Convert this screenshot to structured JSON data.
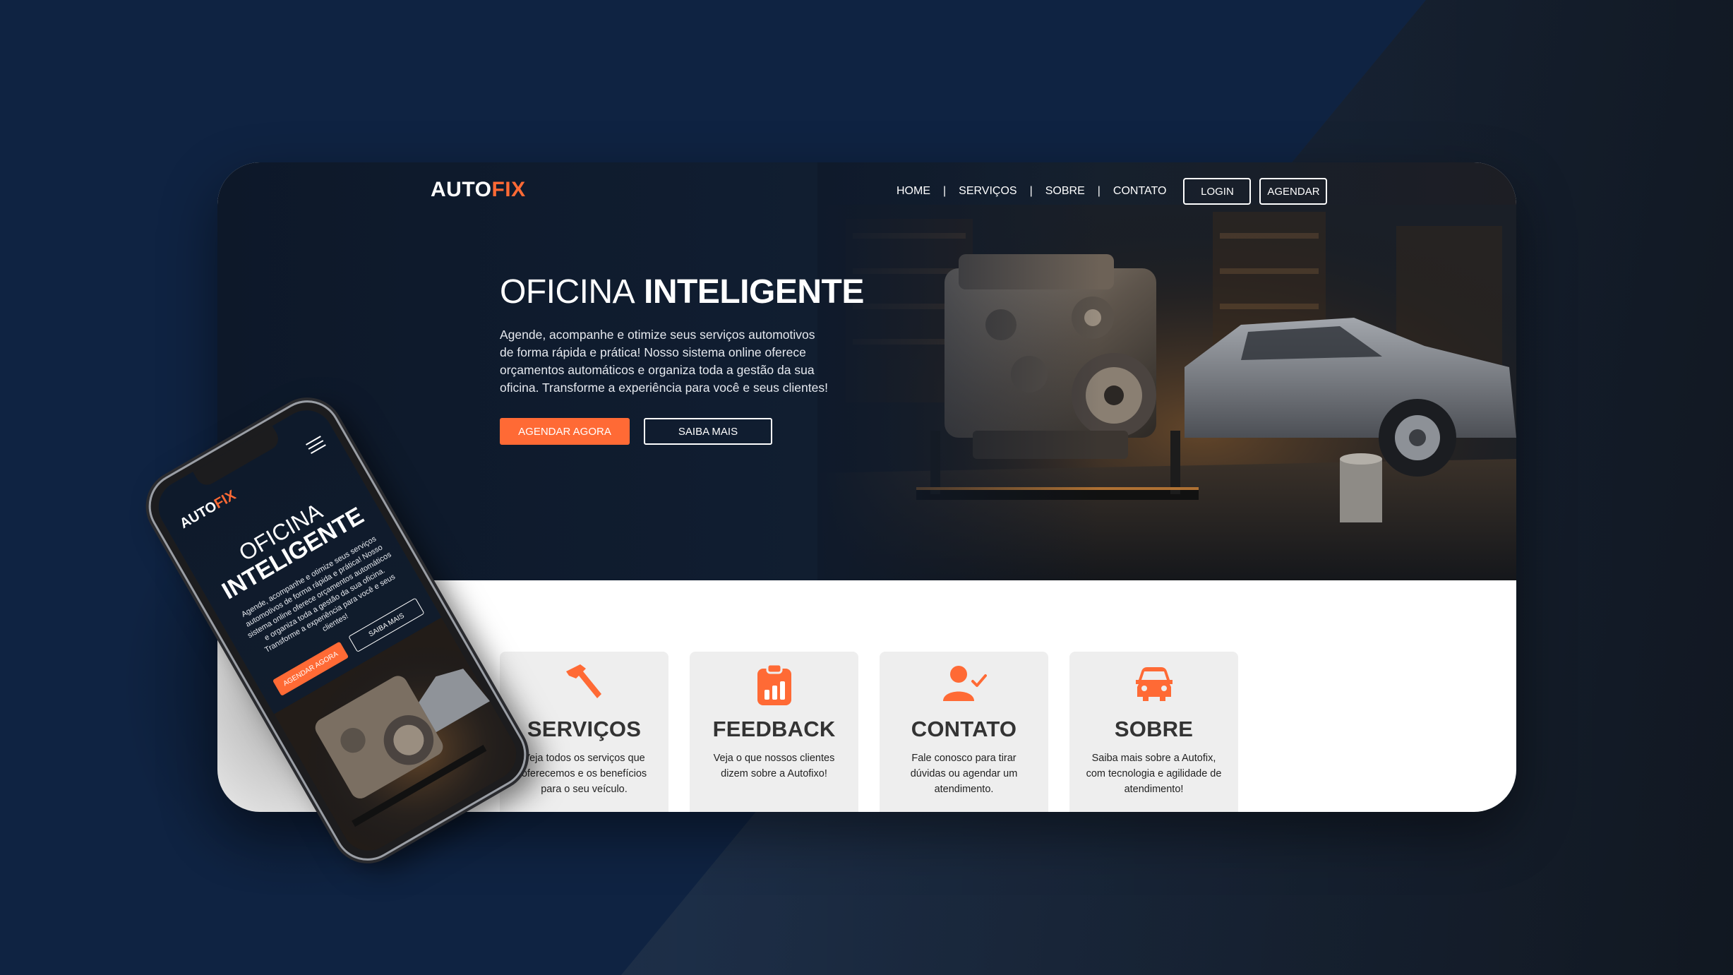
{
  "colors": {
    "accent": "#ff6a35",
    "hero_bg": "#0f1a2b",
    "card_bg": "#eeeeee",
    "page_bg": "#0f2342"
  },
  "brand": {
    "logo_main": "AUTO",
    "logo_accent": "FIX"
  },
  "nav": {
    "links": [
      "HOME",
      "SERVIÇOS",
      "SOBRE",
      "CONTATO"
    ],
    "separator": "|",
    "login_label": "LOGIN",
    "agendar_label": "AGENDAR"
  },
  "hero": {
    "title_light": "OFICINA",
    "title_bold": "INTELIGENTE",
    "description": "Agende, acompanhe e otimize seus serviços automotivos de forma rápida e prática! Nosso sistema online oferece orçamentos automáticos e organiza toda a gestão da sua oficina. Transforme a experiência para você e seus clientes!",
    "primary_button": "AGENDAR AGORA",
    "secondary_button": "SAIBA MAIS"
  },
  "cards": [
    {
      "icon": "hammer-icon",
      "title": "SERVIÇOS",
      "description": "Veja todos os serviços que oferecemos e os benefícios para o seu veículo."
    },
    {
      "icon": "clipboard-chart-icon",
      "title": "FEEDBACK",
      "description": "Veja o que nossos clientes dizem sobre a Autofixo!"
    },
    {
      "icon": "user-check-icon",
      "title": "CONTATO",
      "description": "Fale conosco para tirar dúvidas ou agendar um atendimento."
    },
    {
      "icon": "car-icon",
      "title": "SOBRE",
      "description": "Saiba mais sobre a Autofix, com tecnologia e agilidade de atendimento!"
    }
  ],
  "mobile": {
    "logo_main": "AUTO",
    "logo_accent": "FIX",
    "title_light": "OFICINA",
    "title_bold": "INTELIGENTE",
    "description": "Agende, acompanhe e otimize seus serviços automotivos de forma rápida e prática! Nosso sistema online oferece orçamentos automáticos e organiza toda a gestão da sua oficina. Transforme a experiência para você e seus clientes!",
    "primary_button": "AGENDAR AGORA",
    "secondary_button": "SAIBA MAIS",
    "menu_icon": "hamburger-menu-icon"
  }
}
